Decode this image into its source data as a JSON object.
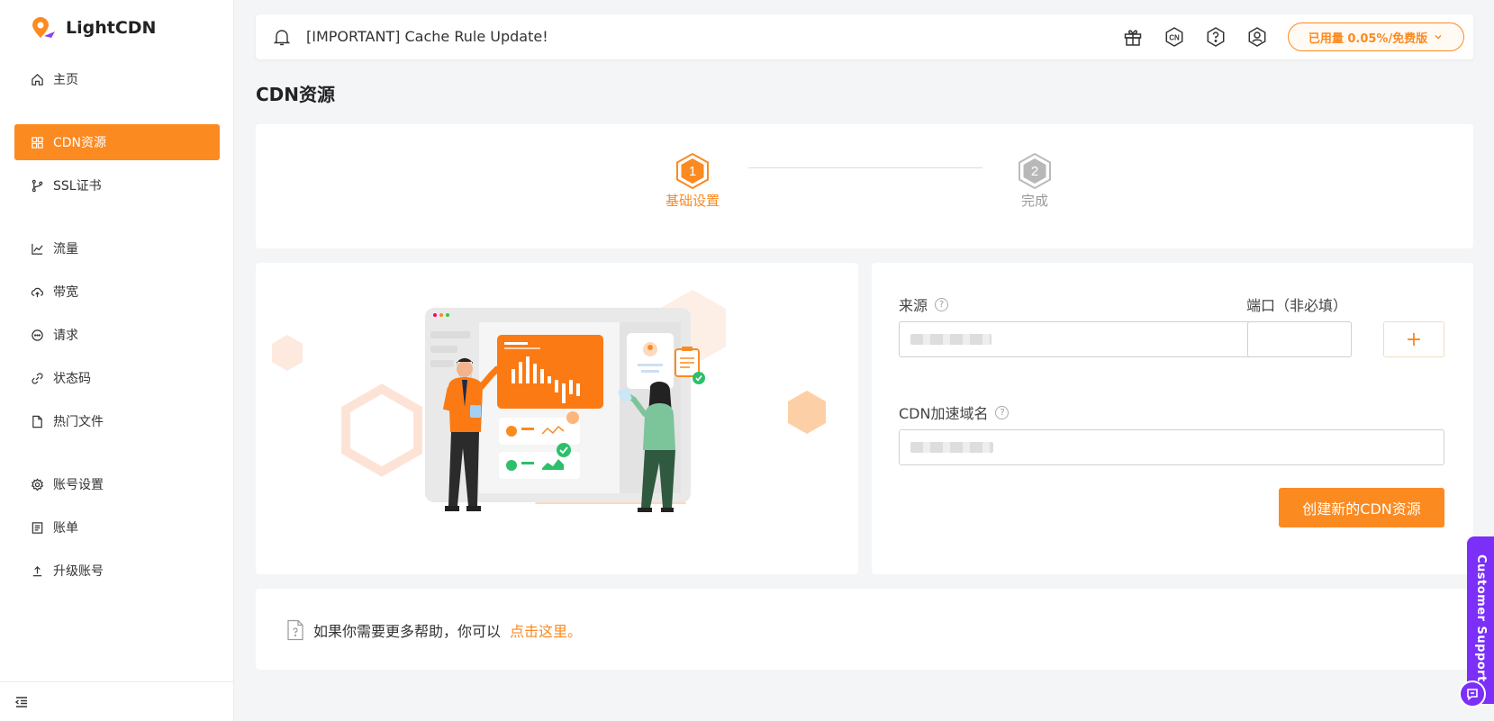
{
  "brand": {
    "name": "LightCDN",
    "accent": "#fb8a21"
  },
  "sidebar": {
    "items": [
      {
        "label": "主页",
        "icon": "home-icon"
      },
      {
        "label": "CDN资源",
        "icon": "grid-icon",
        "active": true
      },
      {
        "label": "SSL证书",
        "icon": "branch-icon"
      },
      {
        "label": "流量",
        "icon": "line-chart-icon"
      },
      {
        "label": "带宽",
        "icon": "cloud-upload-icon"
      },
      {
        "label": "请求",
        "icon": "chat-icon"
      },
      {
        "label": "状态码",
        "icon": "link-icon"
      },
      {
        "label": "热门文件",
        "icon": "file-icon"
      },
      {
        "label": "账号设置",
        "icon": "gear-icon"
      },
      {
        "label": "账单",
        "icon": "bill-icon"
      },
      {
        "label": "升级账号",
        "icon": "upload-icon"
      }
    ]
  },
  "header": {
    "announcement": "[IMPORTANT] Cache Rule Update!",
    "usage_label": "已用量 0.05%/免费版",
    "lang_badge": "CN"
  },
  "page": {
    "title": "CDN资源"
  },
  "steps": [
    {
      "number": "1",
      "label": "基础设置",
      "status": "active"
    },
    {
      "number": "2",
      "label": "完成",
      "status": "pending"
    }
  ],
  "form": {
    "origin_label": "来源",
    "port_label": "端口（非必填）",
    "domain_label": "CDN加速域名",
    "add_button": "+",
    "submit_button": "创建新的CDN资源"
  },
  "help": {
    "text": "如果你需要更多帮助，你可以",
    "link": "点击这里。"
  },
  "support": {
    "label": "Customer Support",
    "color": "#7b2ff7"
  }
}
